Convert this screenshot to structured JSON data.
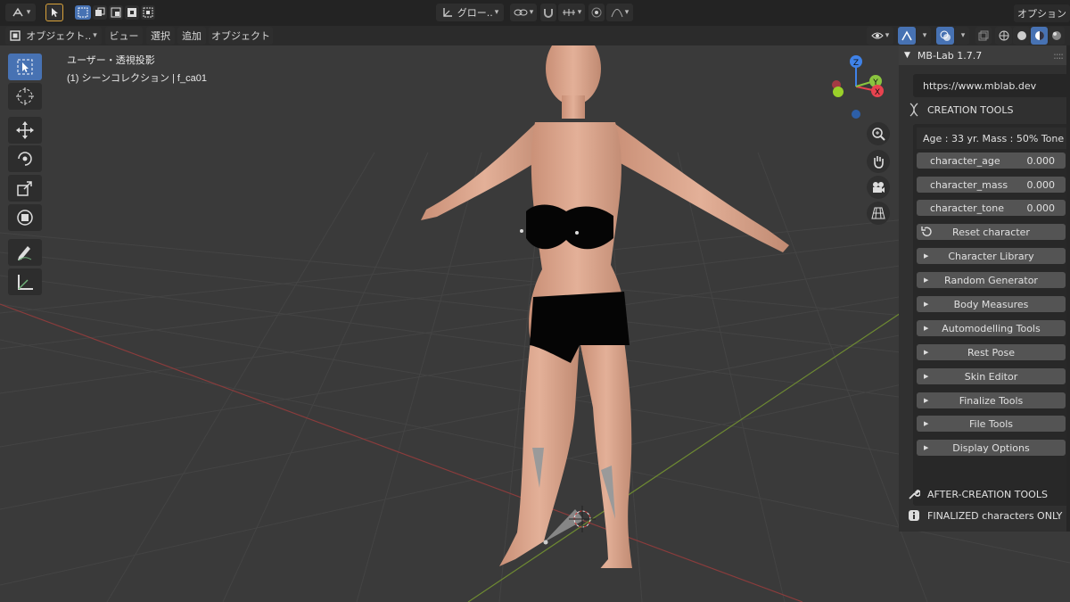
{
  "header": {
    "mode_label": "オブジェクト..",
    "menu": [
      "ビュー",
      "選択",
      "追加",
      "オブジェクト"
    ],
    "transform_orientation": "グロー..",
    "options_label": "オプション"
  },
  "viewport": {
    "view_name": "ユーザー・透視投影",
    "collection_info": "(1) シーンコレクション | f_ca01",
    "gizmo_axes": [
      "Z",
      "Y",
      "X"
    ]
  },
  "npanel": {
    "title": "MB-Lab 1.7.7",
    "url": "https://www.mblab.dev",
    "creation_tools": "CREATION TOOLS",
    "stats": "Age : 33 yr.  Mass : 50%  Tone ..",
    "sliders": [
      {
        "label": "character_age",
        "value": "0.000"
      },
      {
        "label": "character_mass",
        "value": "0.000"
      },
      {
        "label": "character_tone",
        "value": "0.000"
      }
    ],
    "reset_label": "Reset character",
    "sections": [
      "Character Library",
      "Random Generator",
      "Body Measures",
      "Automodelling Tools",
      "Rest Pose",
      "Skin Editor",
      "Finalize Tools",
      "File Tools",
      "Display Options"
    ],
    "after_creation": "AFTER-CREATION TOOLS",
    "finalized_only": "FINALIZED characters ONLY"
  },
  "colors": {
    "accent": "#4772b3",
    "axis_x": "#e8434f",
    "axis_y": "#8bc53f",
    "axis_z": "#3f82e8",
    "skin": "#d8a488"
  }
}
